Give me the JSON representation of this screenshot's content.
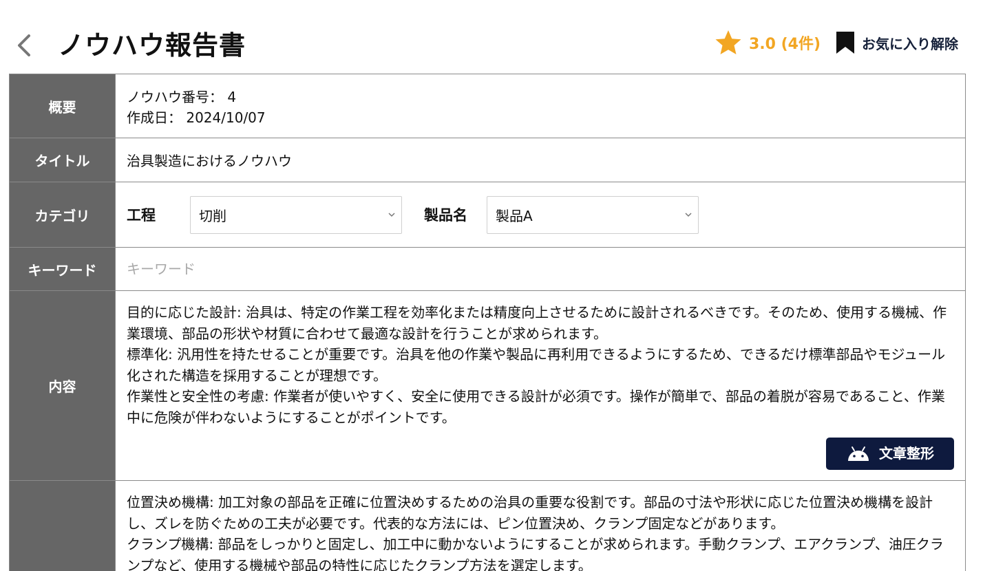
{
  "header": {
    "title": "ノウハウ報告書",
    "rating_text": "3.0 (4件)",
    "favorite_label": "お気に入り解除"
  },
  "overview": {
    "label": "概要",
    "number_line": "ノウハウ番号：  4",
    "date_line": "作成日：  2024/10/07"
  },
  "title_row": {
    "label": "タイトル",
    "value": "治具製造におけるノウハウ"
  },
  "category": {
    "label": "カテゴリ",
    "process_label": "工程",
    "process_value": "切削",
    "product_label": "製品名",
    "product_value": "製品A"
  },
  "keyword": {
    "label": "キーワード",
    "placeholder": "キーワード"
  },
  "content": {
    "label": "内容",
    "paragraphs": [
      "目的に応じた設計: 治具は、特定の作業工程を効率化または精度向上させるために設計されるべきです。そのため、使用する機械、作業環境、部品の形状や材質に合わせて最適な設計を行うことが求められます。",
      "標準化: 汎用性を持たせることが重要です。治具を他の作業や製品に再利用できるようにするため、できるだけ標準部品やモジュール化された構造を採用することが理想です。",
      "作業性と安全性の考慮: 作業者が使いやすく、安全に使用できる設計が必須です。操作が簡単で、部品の着脱が容易であること、作業中に危険が伴わないようにすることがポイントです。"
    ],
    "format_button_label": "文章整形"
  },
  "content2": {
    "paragraphs": [
      "位置決め機構: 加工対象の部品を正確に位置決めするための治具の重要な役割です。部品の寸法や形状に応じた位置決め機構を設計し、ズレを防ぐための工夫が必要です。代表的な方法には、ピン位置決め、クランプ固定などがあります。",
      "クランプ機構: 部品をしっかりと固定し、加工中に動かないようにすることが求められます。手動クランプ、エアクランプ、油圧クランプなど、使用する機械や部品の特性に応じたクランプ方法を選定します。"
    ]
  },
  "colors": {
    "label_bg": "#666666",
    "rating": "#f2a623",
    "button_bg": "#0e1a3e",
    "border": "#8a8a8a"
  },
  "icons": {
    "back": "chevron-left-icon",
    "star": "star-icon",
    "bookmark": "bookmark-icon",
    "select": "chevron-down-icon",
    "format": "android-robot-icon"
  }
}
